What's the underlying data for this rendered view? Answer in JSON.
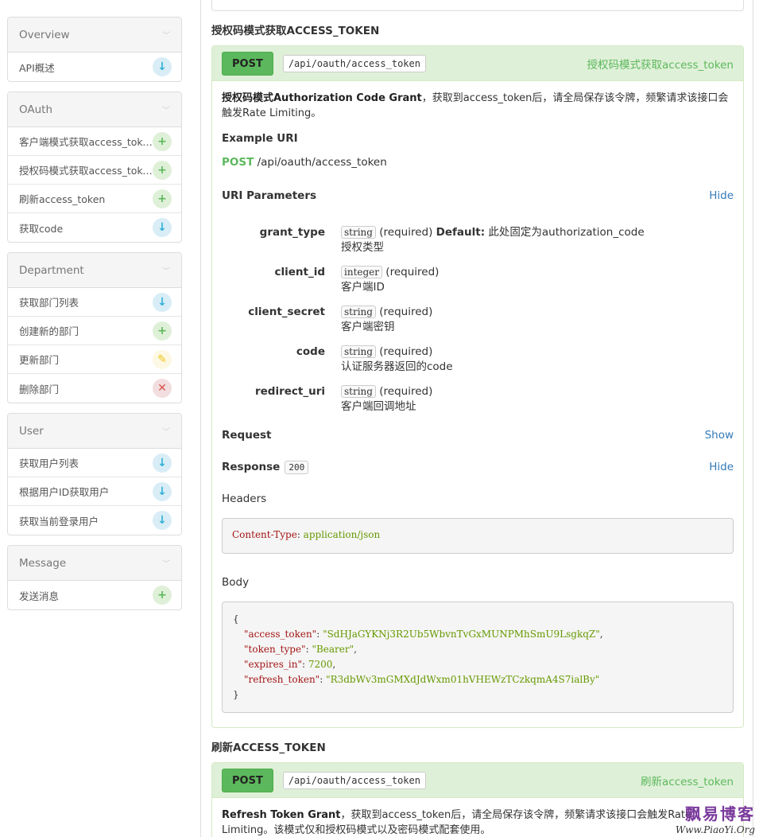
{
  "sidebar": {
    "groups": [
      {
        "title": "Overview",
        "items": [
          {
            "label": "API概述",
            "method": "get"
          }
        ]
      },
      {
        "title": "OAuth",
        "items": [
          {
            "label": "客户端模式获取access_toke…",
            "method": "post"
          },
          {
            "label": "授权码模式获取access_toke…",
            "method": "post"
          },
          {
            "label": "刷新access_token",
            "method": "post"
          },
          {
            "label": "获取code",
            "method": "get"
          }
        ]
      },
      {
        "title": "Department",
        "items": [
          {
            "label": "获取部门列表",
            "method": "get"
          },
          {
            "label": "创建新的部门",
            "method": "post"
          },
          {
            "label": "更新部门",
            "method": "put"
          },
          {
            "label": "删除部门",
            "method": "delete"
          }
        ]
      },
      {
        "title": "User",
        "items": [
          {
            "label": "获取用户列表",
            "method": "get"
          },
          {
            "label": "根据用户ID获取用户",
            "method": "get"
          },
          {
            "label": "获取当前登录用户",
            "method": "get"
          }
        ]
      },
      {
        "title": "Message",
        "items": [
          {
            "label": "发送消息",
            "method": "post"
          }
        ]
      }
    ]
  },
  "section1": {
    "title": "授权码模式获取ACCESS_TOKEN",
    "method": "POST",
    "path": "/api/oauth/access_token",
    "name": "授权码模式获取access_token",
    "desc_bold": "授权码模式Authorization Code Grant",
    "desc_rest": "，获取到access_token后，请全局保存该令牌，频繁请求该接口会触发Rate Limiting。",
    "example_uri_label": "Example URI",
    "example_method": "POST",
    "example_path": " /api/oauth/access_token",
    "uri_params_label": "URI Parameters",
    "uri_params_toggle": "Hide",
    "params": [
      {
        "name": "grant_type",
        "type": "string",
        "req": " (required) ",
        "default_label": "Default:",
        "default_val": " 此处固定为authorization_code",
        "desc": "授权类型"
      },
      {
        "name": "client_id",
        "type": "integer",
        "req": " (required)",
        "desc": "客户端ID"
      },
      {
        "name": "client_secret",
        "type": "string",
        "req": " (required)",
        "desc": "客户端密钥"
      },
      {
        "name": "code",
        "type": "string",
        "req": " (required)",
        "desc": "认证服务器返回的code"
      },
      {
        "name": "redirect_uri",
        "type": "string",
        "req": " (required)",
        "desc": "客户端回调地址"
      }
    ],
    "request_label": "Request",
    "request_toggle": "Show",
    "response_label": "Response",
    "response_code": "200",
    "response_toggle": "Hide",
    "headers_label": "Headers",
    "header_key": "Content-Type",
    "header_sep": ": ",
    "header_val": "application/json",
    "body_label": "Body",
    "body": {
      "open": "{",
      "close": "}",
      "lines": [
        {
          "key": "\"access_token\"",
          "val": "\"SdHJaGYKNj3R2Ub5WbvnTvGxMUNPMhSmU9LsgkqZ\"",
          "type": "s",
          "tail": ","
        },
        {
          "key": "\"token_type\"",
          "val": "\"Bearer\"",
          "type": "s",
          "tail": ","
        },
        {
          "key": "\"expires_in\"",
          "val": "7200",
          "type": "n",
          "tail": ","
        },
        {
          "key": "\"refresh_token\"",
          "val": "\"R3dbWv3mGMXdJdWxm01hVHEWzTCzkqmA4S7ialBy\"",
          "type": "s",
          "tail": ""
        }
      ]
    }
  },
  "section2": {
    "title": "刷新ACCESS_TOKEN",
    "method": "POST",
    "path": "/api/oauth/access_token",
    "name": "刷新access_token",
    "desc_bold": "Refresh Token Grant",
    "desc_rest": "，获取到access_token后，请全局保存该令牌，频繁请求该接口会触发Rate Limiting。该模式仅和授权码模式以及密码模式配套使用。"
  },
  "watermark": {
    "line1": "飘易博客",
    "line2": "Www.PiaoYi.Org"
  },
  "colors": {
    "get": "#31b0d5",
    "post": "#5cb85c",
    "put": "#f0c419",
    "delete": "#d9534f"
  }
}
